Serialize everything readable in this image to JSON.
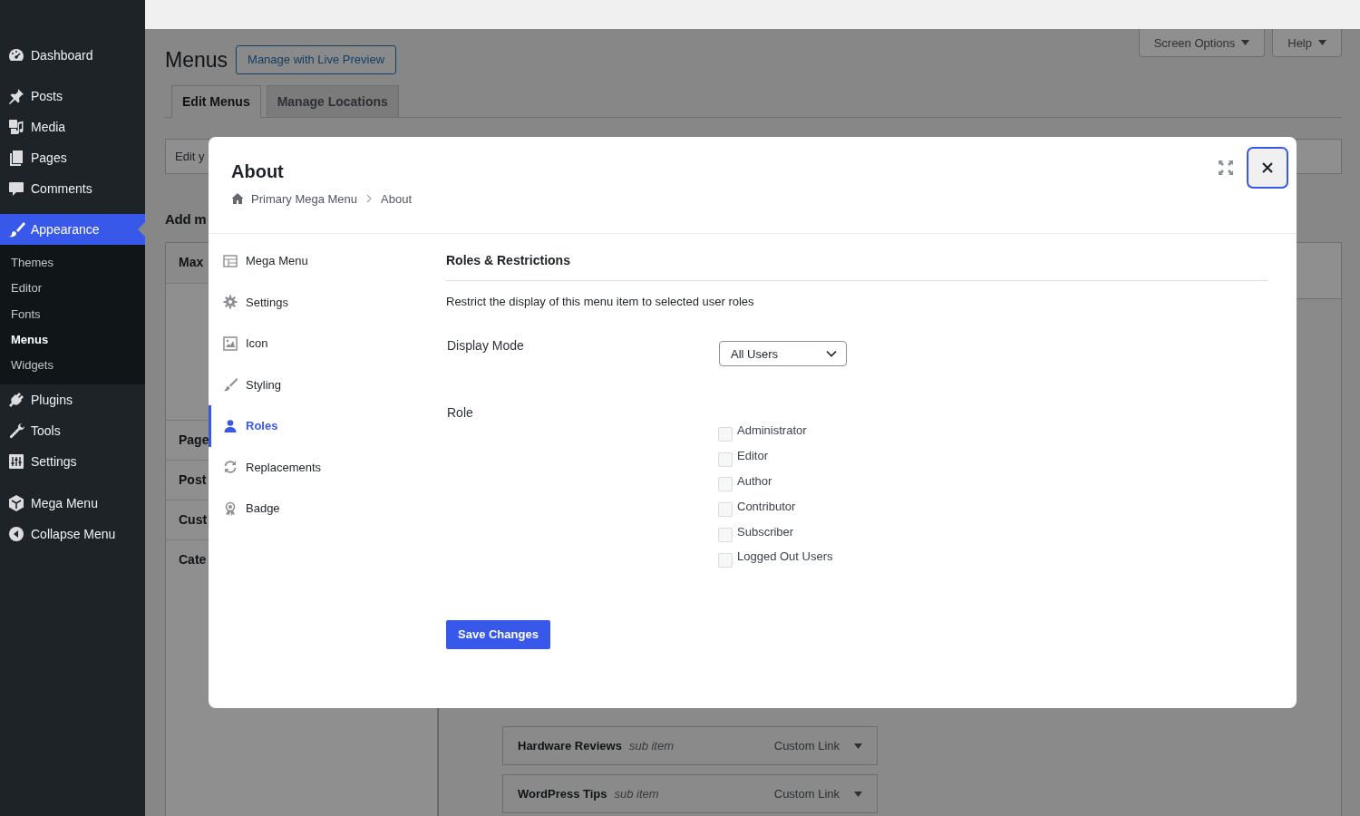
{
  "admin_menu": {
    "items": [
      {
        "label": "Dashboard",
        "selected": false
      },
      {
        "label": "Posts",
        "selected": false
      },
      {
        "label": "Media",
        "selected": false
      },
      {
        "label": "Pages",
        "selected": false
      },
      {
        "label": "Comments",
        "selected": false
      },
      {
        "label": "Appearance",
        "selected": true,
        "children": [
          {
            "label": "Themes",
            "selected": false
          },
          {
            "label": "Editor",
            "selected": false
          },
          {
            "label": "Fonts",
            "selected": false
          },
          {
            "label": "Menus",
            "selected": true
          },
          {
            "label": "Widgets",
            "selected": false
          }
        ]
      },
      {
        "label": "Plugins",
        "selected": false
      },
      {
        "label": "Tools",
        "selected": false
      },
      {
        "label": "Settings",
        "selected": false
      },
      {
        "label": "Mega Menu",
        "selected": false
      },
      {
        "label": "Collapse Menu",
        "selected": false
      }
    ]
  },
  "screen_meta": [
    "Screen Options",
    "Help"
  ],
  "page": {
    "title": "Menus",
    "action": "Manage with Live Preview",
    "tabs": [
      {
        "label": "Edit Menus",
        "selected": true
      },
      {
        "label": "Manage Locations",
        "selected": false
      }
    ],
    "notice": "Edit y",
    "section_title": "Add m",
    "panels": [
      "Max",
      "Page",
      "Post",
      "Cust",
      "Cate"
    ],
    "menu_items": [
      {
        "title": "Hardware Reviews",
        "note": "sub item",
        "type": "Custom Link"
      },
      {
        "title": "WordPress Tips",
        "note": "sub item",
        "type": "Custom Link"
      }
    ]
  },
  "modal": {
    "title": "About",
    "breadcrumb": [
      "Primary Mega Menu",
      "About"
    ],
    "nav": [
      {
        "label": "Mega Menu",
        "selected": false
      },
      {
        "label": "Settings",
        "selected": false
      },
      {
        "label": "Icon",
        "selected": false
      },
      {
        "label": "Styling",
        "selected": false
      },
      {
        "label": "Roles",
        "selected": true
      },
      {
        "label": "Replacements",
        "selected": false
      },
      {
        "label": "Badge",
        "selected": false
      }
    ],
    "section": {
      "title": "Roles & Restrictions",
      "description": "Restrict the display of this menu item to selected user roles",
      "display_mode": {
        "label": "Display Mode",
        "value": "All Users"
      },
      "role": {
        "label": "Role",
        "options": [
          {
            "label": "Administrator",
            "checked": false
          },
          {
            "label": "Editor",
            "checked": false
          },
          {
            "label": "Author",
            "checked": false
          },
          {
            "label": "Contributor",
            "checked": false
          },
          {
            "label": "Subscriber",
            "checked": false
          },
          {
            "label": "Logged Out Users",
            "checked": false
          }
        ]
      }
    },
    "save": "Save Changes"
  }
}
